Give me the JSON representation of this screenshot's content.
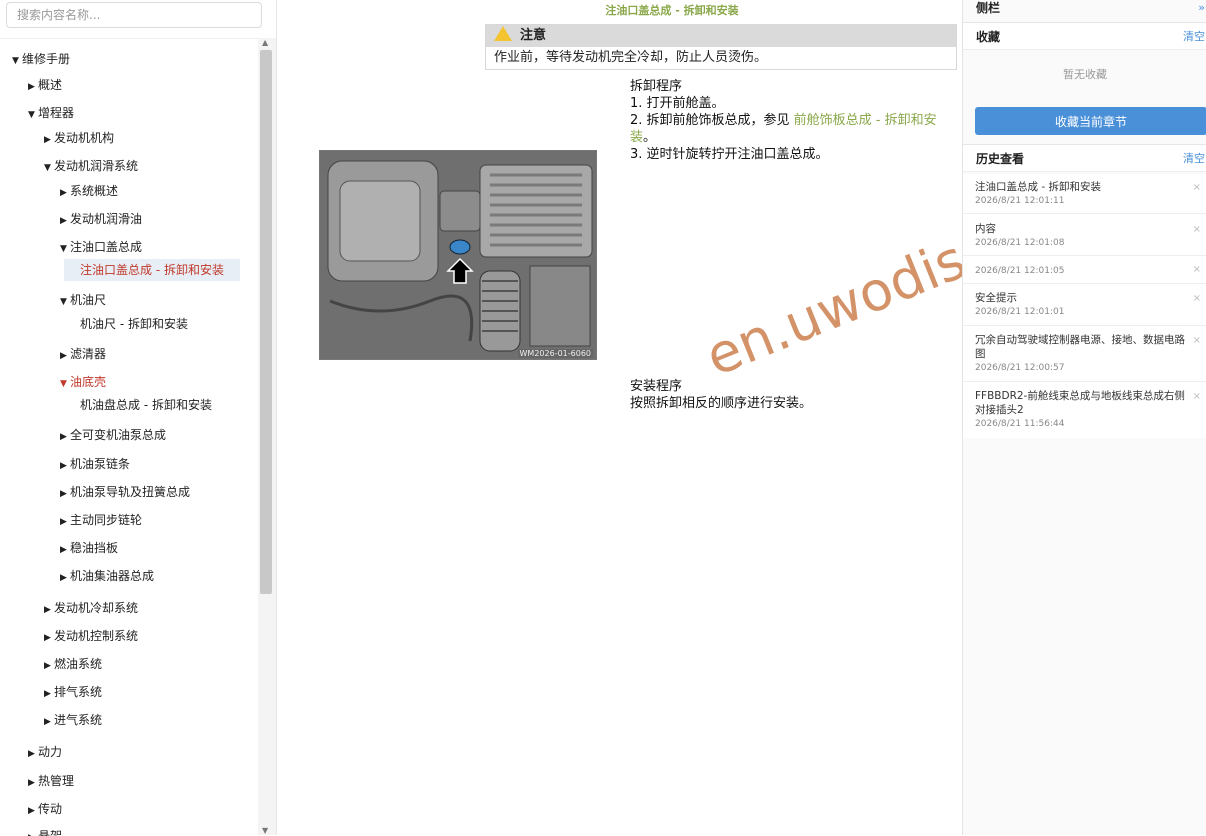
{
  "search": {
    "placeholder": "搜索内容名称..."
  },
  "tree": {
    "items": [
      {
        "label": "维修手册",
        "arrow": "▼"
      },
      {
        "label": "概述",
        "arrow": "▶"
      },
      {
        "label": "增程器",
        "arrow": "▼"
      },
      {
        "label": "发动机机构",
        "arrow": "▶"
      },
      {
        "label": "发动机润滑系统",
        "arrow": "▼"
      },
      {
        "label": "系统概述",
        "arrow": "▶"
      },
      {
        "label": "发动机润滑油",
        "arrow": "▶"
      },
      {
        "label": "注油口盖总成",
        "arrow": "▼"
      },
      {
        "label": "注油口盖总成 - 拆卸和安装",
        "arrow": ""
      },
      {
        "label": "机油尺",
        "arrow": "▼"
      },
      {
        "label": "机油尺 - 拆卸和安装",
        "arrow": ""
      },
      {
        "label": "滤清器",
        "arrow": "▶"
      },
      {
        "label": "油底壳",
        "arrow": "▼"
      },
      {
        "label": "机油盘总成 - 拆卸和安装",
        "arrow": ""
      },
      {
        "label": "全可变机油泵总成",
        "arrow": "▶"
      },
      {
        "label": "机油泵链条",
        "arrow": "▶"
      },
      {
        "label": "机油泵导轨及扭簧总成",
        "arrow": "▶"
      },
      {
        "label": "主动同步链轮",
        "arrow": "▶"
      },
      {
        "label": "稳油挡板",
        "arrow": "▶"
      },
      {
        "label": "机油集油器总成",
        "arrow": "▶"
      },
      {
        "label": "发动机冷却系统",
        "arrow": "▶"
      },
      {
        "label": "发动机控制系统",
        "arrow": "▶"
      },
      {
        "label": "燃油系统",
        "arrow": "▶"
      },
      {
        "label": "排气系统",
        "arrow": "▶"
      },
      {
        "label": "进气系统",
        "arrow": "▶"
      },
      {
        "label": "动力",
        "arrow": "▶"
      },
      {
        "label": "热管理",
        "arrow": "▶"
      },
      {
        "label": "传动",
        "arrow": "▶"
      },
      {
        "label": "悬架",
        "arrow": "▶"
      }
    ]
  },
  "content": {
    "title": "注油口盖总成 - 拆卸和安装",
    "notice_title": "注意",
    "notice_text": "作业前，等待发动机完全冷却，防止人员烫伤。",
    "removal_heading": "拆卸程序",
    "step1": "1. 打开前舱盖。",
    "step2_prefix": "2. 拆卸前舱饰板总成，参见 ",
    "step2_link": "前舱饰板总成 - 拆卸和安装",
    "step2_suffix": "。",
    "step3": "3. 逆时针旋转拧开注油口盖总成。",
    "figure_caption": "WM2026-01-6060",
    "install_heading": "安装程序",
    "install_text": "按照拆卸相反的顺序进行安装。",
    "watermark": "en.uwodis.com"
  },
  "sidebar": {
    "title": "侧栏",
    "collapse_label": "»",
    "favorites_title": "收藏",
    "favorites_clear": "清空",
    "favorites_empty": "暂无收藏",
    "favorite_button": "收藏当前章节",
    "history_title": "历史查看",
    "history_clear": "清空",
    "history": [
      {
        "title": "注油口盖总成 - 拆卸和安装",
        "time": "2026/8/21 12:01:11"
      },
      {
        "title": "内容",
        "time": "2026/8/21 12:01:08"
      },
      {
        "title": "",
        "time": "2026/8/21 12:01:05"
      },
      {
        "title": "安全提示",
        "time": "2026/8/21 12:01:01"
      },
      {
        "title": "冗余自动驾驶域控制器电源、接地、数据电路图",
        "time": "2026/8/21 12:00:57"
      },
      {
        "title": "FFBBDR2-前舱线束总成与地板线束总成右侧对接插头2",
        "time": "2026/8/21 11:56:44"
      }
    ],
    "remove_icon": "×"
  },
  "colors": {
    "accent": "#4a90d9",
    "link_green": "#8aa84a",
    "active_red": "#c0392b",
    "watermark": "#c46e34"
  }
}
